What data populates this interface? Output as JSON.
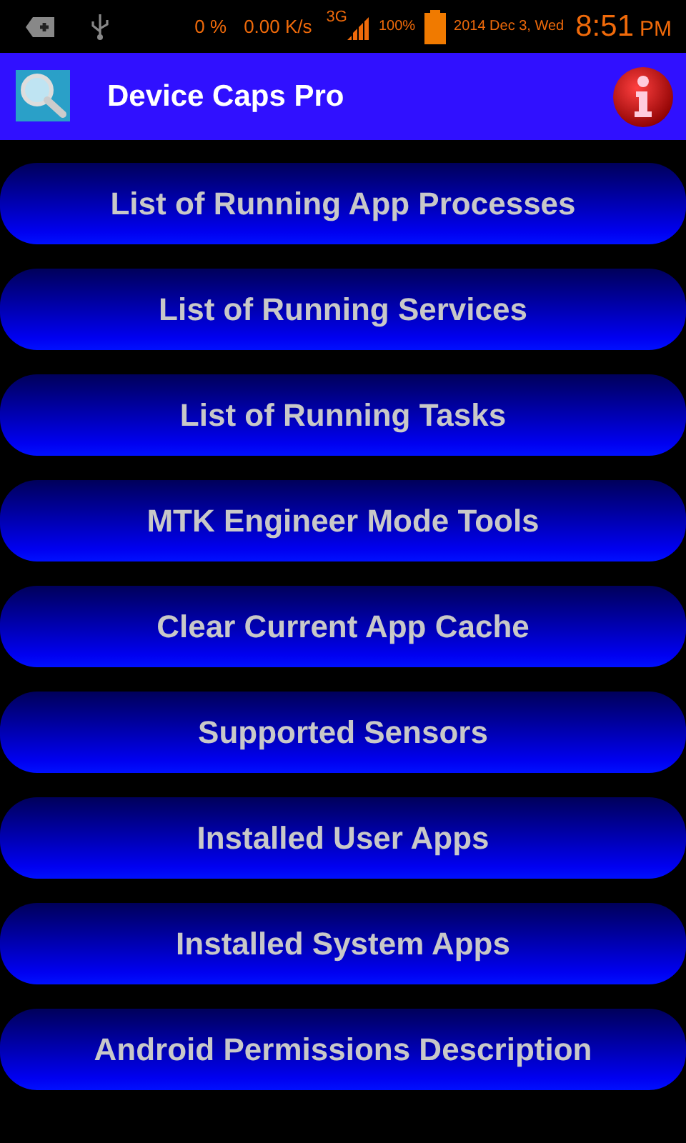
{
  "status_bar": {
    "cpu": "0 %",
    "speed": "0.00 K/s",
    "network": "3G",
    "battery": "100%",
    "date": "2014 Dec 3, Wed",
    "time": "8:51",
    "ampm": "PM"
  },
  "app_bar": {
    "title": "Device Caps Pro"
  },
  "menu": [
    {
      "label": "List of Running App Processes"
    },
    {
      "label": "List of Running Services"
    },
    {
      "label": "List of Running Tasks"
    },
    {
      "label": "MTK Engineer Mode Tools"
    },
    {
      "label": "Clear Current App Cache"
    },
    {
      "label": "Supported Sensors"
    },
    {
      "label": "Installed User Apps"
    },
    {
      "label": "Installed System Apps"
    },
    {
      "label": "Android Permissions Description"
    }
  ]
}
